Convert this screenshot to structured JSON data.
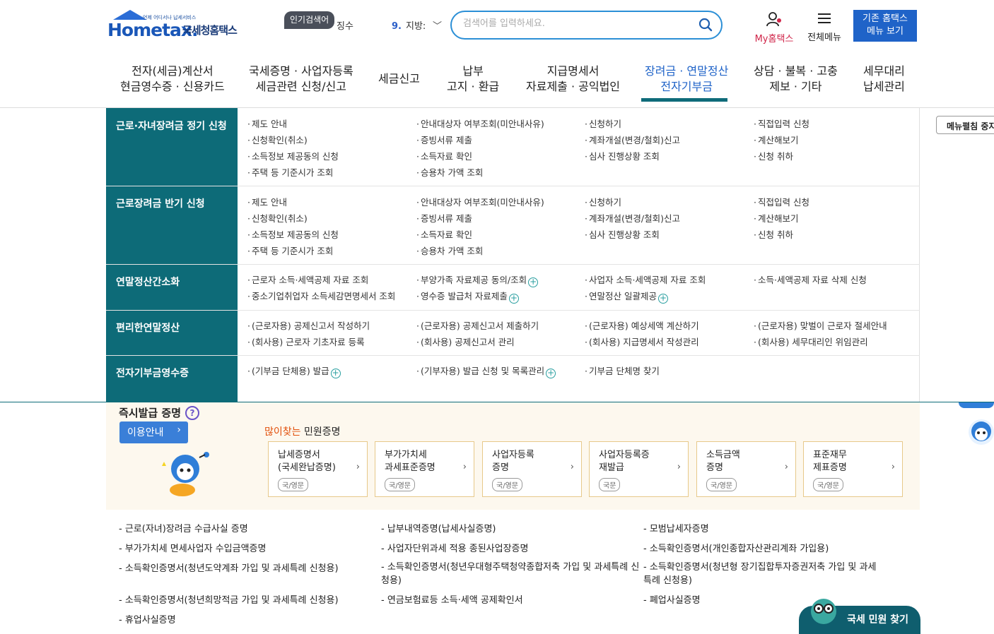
{
  "header": {
    "logo_sub": "언제 어디서나 납세서비스",
    "logo_en": "Hometax.",
    "logo_ko": "국세청홈택스",
    "popular_badge": "인기검색어",
    "popular_item_prev": "징수",
    "popular_rank": "9.",
    "popular_item": "지방:",
    "search_placeholder": "검색어를 입력하세요.",
    "my_label": "My홈택스",
    "allmenu_label": "전체메뉴",
    "old_button_line1": "기존 홈택스",
    "old_button_line2": "메뉴 보기"
  },
  "gnb": [
    {
      "l1": "전자(세금)계산서",
      "l2": "현금영수증 · 신용카드"
    },
    {
      "l1": "국세증명 · 사업자등록",
      "l2": "세금관련 신청/신고"
    },
    {
      "l1": "세금신고",
      "l2": ""
    },
    {
      "l1": "납부",
      "l2": "고지 · 환급"
    },
    {
      "l1": "지급명세서",
      "l2": "자료제출 · 공익법인"
    },
    {
      "l1": "장려금 · 연말정산",
      "l2": "전자기부금"
    },
    {
      "l1": "상담 · 불복 · 고충",
      "l2": "제보 · 기타"
    },
    {
      "l1": "세무대리",
      "l2": "납세관리"
    }
  ],
  "mega": [
    {
      "category": "근로·자녀장려금 정기 신청",
      "links": [
        "제도 안내",
        "신청확인(취소)",
        "소득정보 제공동의 신청",
        "주택 등 기준시가 조회",
        "안내대상자 여부조회(미안내사유)",
        "증빙서류 제출",
        "소득자료 확인",
        "승용차 가액 조회",
        "신청하기",
        "계좌개설(변경/철회)신고",
        "심사 진행상황 조회",
        "직접입력 신청",
        "계산해보기",
        "신청 취하"
      ]
    },
    {
      "category": "근로장려금 반기 신청",
      "links": [
        "제도 안내",
        "신청확인(취소)",
        "소득정보 제공동의 신청",
        "주택 등 기준시가 조회",
        "안내대상자 여부조회(미안내사유)",
        "증빙서류 제출",
        "소득자료 확인",
        "승용차 가액 조회",
        "신청하기",
        "계좌개설(변경/철회)신고",
        "심사 진행상황 조회",
        "직접입력 신청",
        "계산해보기",
        "신청 취하"
      ]
    },
    {
      "category": "연말정산간소화",
      "links": [
        "근로자 소득·세액공제 자료 조회",
        "중소기업취업자 소득세감면명세서 조회",
        "부양가족 자료제공 동의/조회",
        "영수증 발급처 자료제출",
        "사업자 소득·세액공제 자료 조회",
        "연말정산 일괄제공",
        "소득·세액공제 자료 삭제 신청"
      ]
    },
    {
      "category": "편리한연말정산",
      "links": [
        "(근로자용) 공제신고서 작성하기",
        "(회사용) 근로자 기초자료 등록",
        "(근로자용) 공제신고서 제출하기",
        "(회사용) 공제신고서 관리",
        "(근로자용) 예상세액 계산하기",
        "(회사용) 지급명세서 작성관리",
        "(근로자용) 맞벌이 근로자 절세안내",
        "(회사용) 세무대리인 위임관리"
      ]
    },
    {
      "category": "전자기부금영수증",
      "links": [
        "(기부금 단체용) 발급",
        "(기부자용) 발급 신청 및 목록관리",
        "기부금 단체명 찾기"
      ]
    }
  ],
  "menu_edit_label": "메뉴펼침 중지",
  "instant": {
    "title": "즉시발급 증명",
    "help": "?",
    "guide_label": "이용안내",
    "popular_hl": "많이찾는",
    "popular_rest": " 민원증명",
    "cards": [
      {
        "l1": "납세증명서",
        "l2": "(국세완납증명)",
        "tag": "국/영문"
      },
      {
        "l1": "부가가치세",
        "l2": "과세표준증명",
        "tag": "국/영문"
      },
      {
        "l1": "사업자등록",
        "l2": "증명",
        "tag": "국/영문"
      },
      {
        "l1": "사업자등록증",
        "l2": "재발급",
        "tag": "국문"
      },
      {
        "l1": "소득금액",
        "l2": "증명",
        "tag": "국/영문"
      },
      {
        "l1": "표준재무",
        "l2": "제표증명",
        "tag": "국/영문"
      }
    ]
  },
  "certs": [
    "근로(자녀)장려금 수급사실 증명",
    "납부내역증명(납세사실증명)",
    "모범납세자증명",
    "부가가치세 면세사업자 수입금액증명",
    "사업자단위과세 적용 종된사업장증명",
    "소득확인증명서(개인종합자산관리계좌 가입용)",
    "소득확인증명서(청년도약계좌 가입 및 과세특례 신청용)",
    "소득확인증명서(청년우대형주택청약종합저축 가입 및 과세특례 신청용)",
    "소득확인증명서(청년형 장기집합투자증권저축 가입 및 과세특례 신청용)",
    "소득확인증명서(청년희망적금 가입 및 과세특례 신청용)",
    "연금보험료등 소득·세액 공제확인서",
    "폐업사실증명",
    "휴업사실증명"
  ],
  "find_button": "국세 민원 찾기",
  "colors": {
    "accent": "#0d6b78",
    "brand": "#1f63c8",
    "my": "#d0264a"
  }
}
